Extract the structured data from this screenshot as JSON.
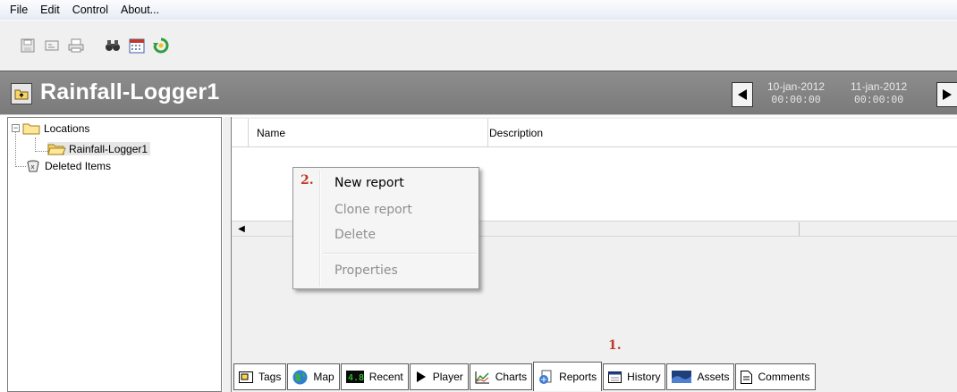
{
  "menubar": [
    "File",
    "Edit",
    "Control",
    "About..."
  ],
  "toolbar": {
    "icons": [
      "save-icon",
      "properties-icon",
      "print-icon",
      "binoculars-icon",
      "calendar-icon",
      "refresh-icon"
    ]
  },
  "header": {
    "title": "Rainfall-Logger1",
    "date_from": "10-jan-2012",
    "time_from": "00:00:00",
    "date_to": "11-jan-2012",
    "time_to": "00:00:00"
  },
  "tree": {
    "root": "Locations",
    "child": "Rainfall-Logger1",
    "deleted": "Deleted Items"
  },
  "grid": {
    "col_name": "Name",
    "col_description": "Description"
  },
  "context_menu": {
    "step": "2.",
    "items": [
      "New report",
      "Clone report",
      "Delete",
      "Properties"
    ]
  },
  "tabs": {
    "step": "1.",
    "items": [
      "Tags",
      "Map",
      "Recent",
      "Player",
      "Charts",
      "Reports",
      "History",
      "Assets",
      "Comments"
    ],
    "active": "Reports"
  },
  "colors": {
    "title_bar": "#858585",
    "step_marker": "#c0392b"
  }
}
